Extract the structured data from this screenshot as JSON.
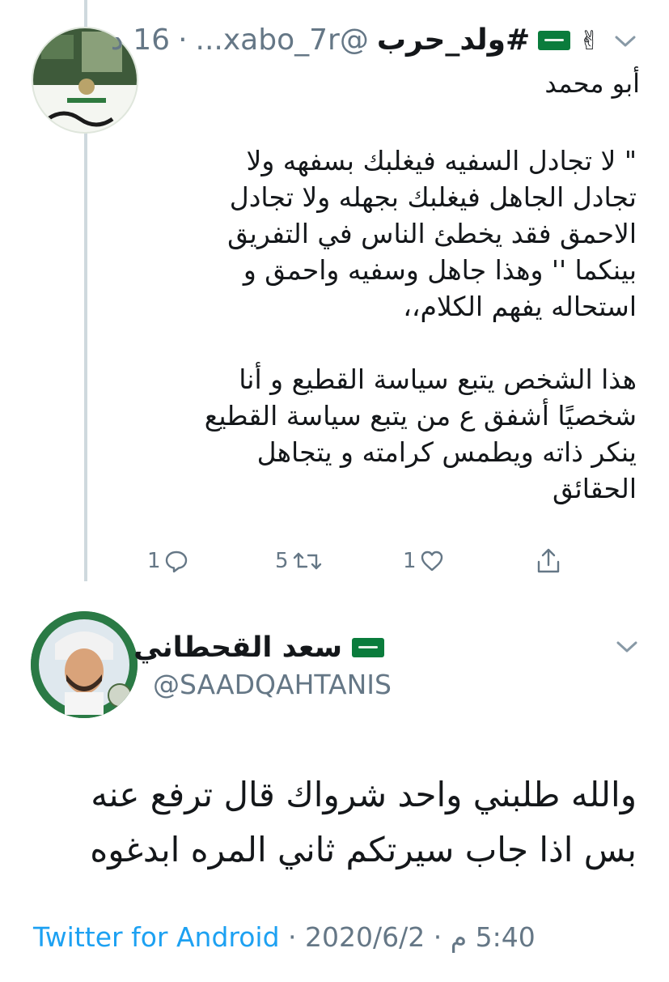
{
  "parent_tweet": {
    "time_ago": "16 د",
    "handle": "@xabo_7r...",
    "display_name": "#ولد_حرب",
    "sub_name": "أبو محمد",
    "text": "\" لا تجادل السفيه فيغلبك بسفهه ولا\nتجادل الجاهل فيغلبك بجهله ولا تجادل\nالاحمق فقد يخطئ الناس في التفريق\nبينكما '' وهذا جاهل وسفيه واحمق و\nاستحاله يفهم الكلام،،\n\nهذا الشخص يتبع سياسة القطيع و أنا\nشخصيًا أشفق ع من يتبع سياسة القطيع\nينكر ذاته ويطمس كرامته و يتجاهل\nالحقائق",
    "reply_count": "1",
    "retweet_count": "5",
    "like_count": "1"
  },
  "main_tweet": {
    "display_name": "سعد القحطاني",
    "handle": "@SAADQAHTANIS",
    "text": "والله طلبني واحد شرواك قال ترفع عنه\nبس اذا جاب سيرتكم ثاني المره ابدغوه",
    "time": "5:40 م",
    "date": "2020/6/2",
    "source": "Twitter for Android"
  },
  "colors": {
    "link": "#1da1f2",
    "muted": "#657786",
    "flag_green": "#0a7c3c",
    "thread_line": "#cfd9de"
  },
  "icons": [
    "chevron-down-icon",
    "reply-icon",
    "retweet-icon",
    "like-icon",
    "share-icon",
    "saudi-flag-icon",
    "victory-hand-icon"
  ]
}
